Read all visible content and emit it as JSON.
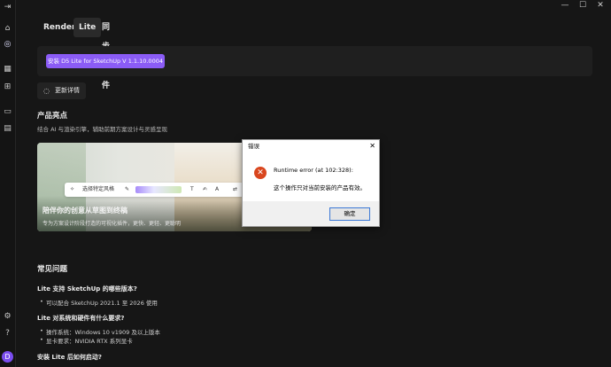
{
  "window": {
    "controls": {
      "minimize": "—",
      "maximize": "☐",
      "close": "✕"
    }
  },
  "sidebar": {
    "icons": [
      "collapse-icon",
      "home-icon",
      "plugin-icon",
      "assets-icon",
      "apps-icon",
      "window-icon",
      "folder-icon",
      "settings-icon",
      "help-icon"
    ],
    "avatar_letter": "D"
  },
  "tabs": [
    {
      "label": "Render"
    },
    {
      "label": "Lite"
    },
    {
      "label": "同步插件"
    }
  ],
  "install": {
    "label": "安装 D5 Lite for SketchUp V 1.1.10.0004"
  },
  "changelog": {
    "label": "更新详情"
  },
  "highlights": {
    "title": "产品亮点",
    "subtitle": "结合 AI 与渲染引擎，辅助前期方案设计与灵感呈现",
    "banner_title": "陪伴你的创意从草图到终稿",
    "banner_subtitle": "专为方案设计阶段打造的可视化插件，更快、更轻、更聪明",
    "toolbar_label": "选择特定风格"
  },
  "dialog": {
    "title": "错误",
    "line1": "Runtime error (at 102:328):",
    "line2": "这个操作只对当前安装的产品有效。",
    "ok_label": "确定"
  },
  "faq": {
    "title": "常见问题",
    "items": [
      {
        "q": "Lite 支持 SketchUp 的哪些版本?",
        "answers": [
          "可以配合 SketchUp 2021.1 至 2026 使用"
        ]
      },
      {
        "q": "Lite 对系统和硬件有什么要求?",
        "answers": [
          "操作系统：Windows 10 v1909 及以上版本",
          "显卡要求：NVIDIA RTX 系列显卡"
        ]
      },
      {
        "q": "安装 Lite 后如何启动?",
        "answers": []
      }
    ]
  },
  "colors": {
    "accent": "#8b5cf6",
    "background": "#161616",
    "panel": "#1f1f1f",
    "error": "#d9461e"
  }
}
